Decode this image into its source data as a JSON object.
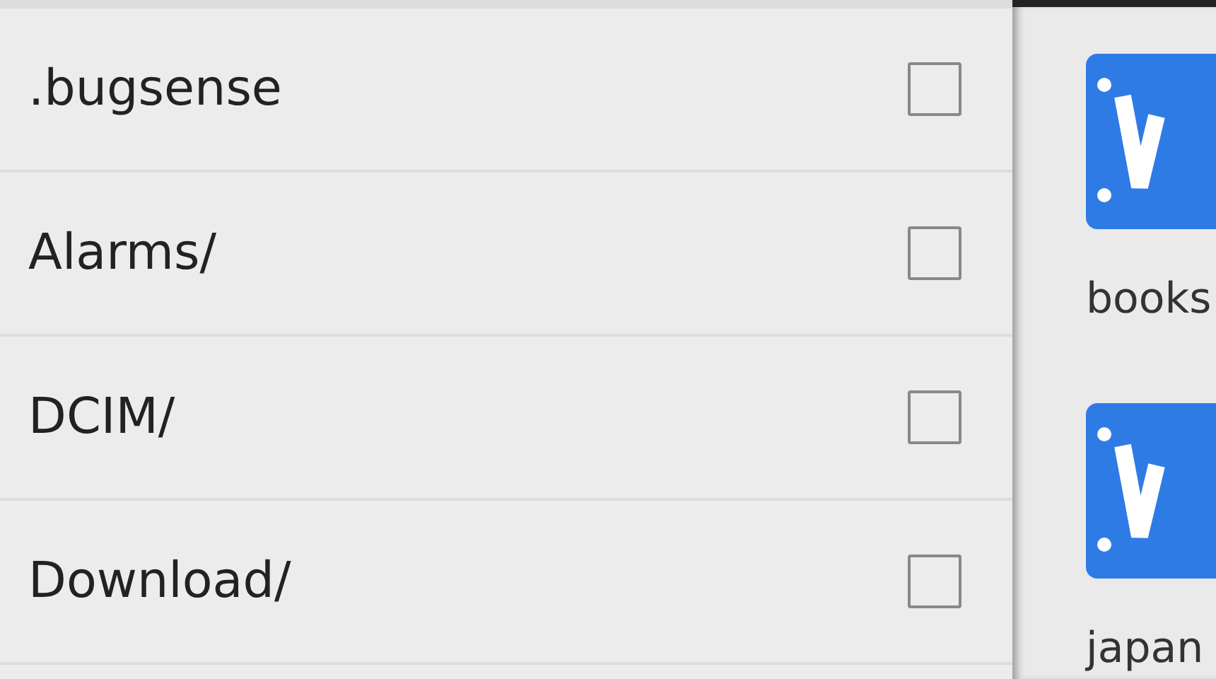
{
  "files": [
    {
      "name": ".bugsense",
      "checked": false
    },
    {
      "name": "Alarms/",
      "checked": false
    },
    {
      "name": "DCIM/",
      "checked": false
    },
    {
      "name": "Download/",
      "checked": false
    }
  ],
  "side_items": [
    {
      "label": "books"
    },
    {
      "label": "japan"
    }
  ]
}
